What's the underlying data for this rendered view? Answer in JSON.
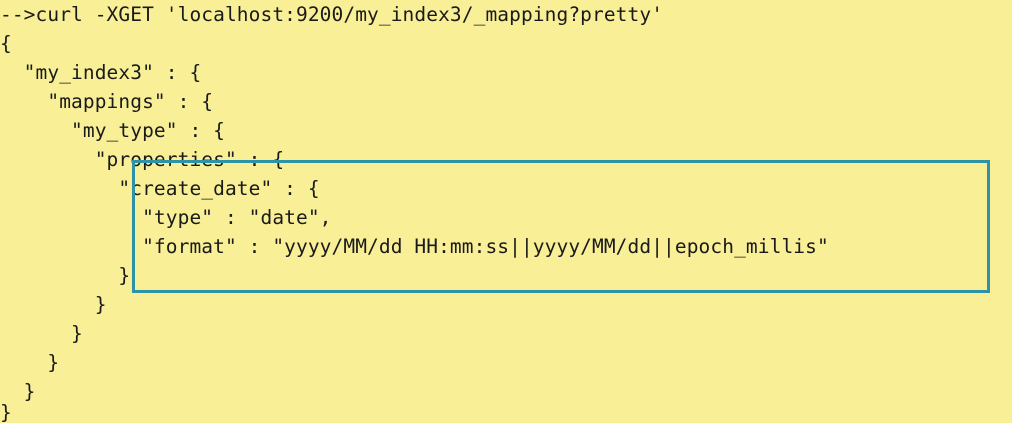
{
  "terminal": {
    "lines": [
      "-->curl -XGET 'localhost:9200/my_index3/_mapping?pretty'",
      "{",
      "  \"my_index3\" : {",
      "    \"mappings\" : {",
      "      \"my_type\" : {",
      "        \"properties\" : {",
      "          \"create_date\" : {",
      "            \"type\" : \"date\",",
      "            \"format\" : \"yyyy/MM/dd HH:mm:ss||yyyy/MM/dd||epoch_millis\"",
      "          }",
      "        }",
      "      }",
      "    }",
      "  }",
      "}"
    ]
  },
  "colors": {
    "background": "#f8ef96",
    "text": "#1a1a1a",
    "highlight_border": "#2f93a6"
  }
}
